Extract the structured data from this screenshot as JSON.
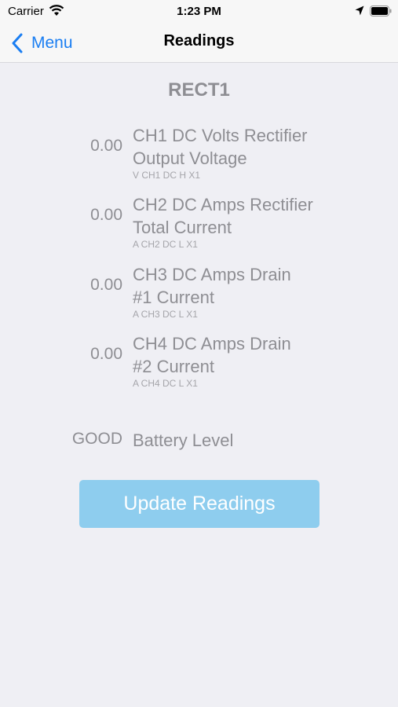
{
  "status_bar": {
    "carrier": "Carrier",
    "time": "1:23 PM"
  },
  "nav": {
    "back_label": "Menu",
    "title": "Readings"
  },
  "device_name": "RECT1",
  "readings": [
    {
      "value": "0.00",
      "label_line1": "CH1 DC Volts Rectifier",
      "label_line2": "Output Voltage",
      "sub": "V CH1 DC H X1"
    },
    {
      "value": "0.00",
      "label_line1": "CH2 DC Amps Rectifier",
      "label_line2": "Total Current",
      "sub": "A CH2 DC L X1"
    },
    {
      "value": "0.00",
      "label_line1": "CH3 DC Amps Drain",
      "label_line2": "#1 Current",
      "sub": "A CH3 DC L X1"
    },
    {
      "value": "0.00",
      "label_line1": "CH4 DC Amps Drain",
      "label_line2": "#2 Current",
      "sub": "A CH4 DC L X1"
    }
  ],
  "battery": {
    "value": "GOOD",
    "label": "Battery Level"
  },
  "update_button_label": "Update Readings",
  "colors": {
    "accent": "#1a7ef2",
    "button": "#8ecdee",
    "text_muted": "#8e8e93",
    "background": "#efeff4"
  }
}
